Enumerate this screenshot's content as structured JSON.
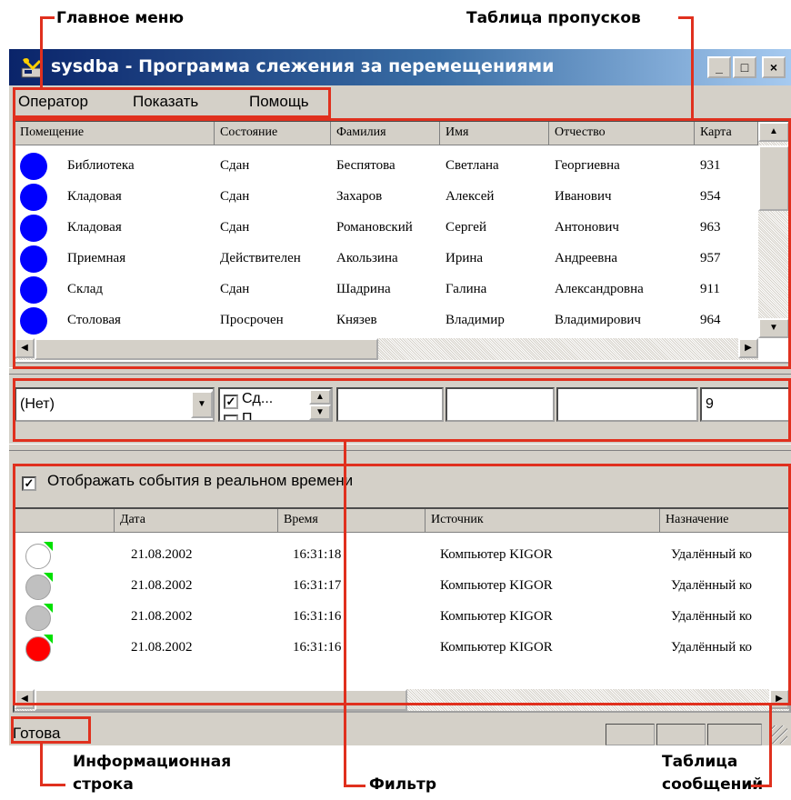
{
  "annotations": {
    "main_menu": "Главное меню",
    "pass_table": "Таблица пропусков",
    "info_line_1": "Информационная",
    "info_line_2": "строка",
    "filter": "Фильтр",
    "messages_1": "Таблица",
    "messages_2": "сообщений"
  },
  "window": {
    "title": "sysdba - Программа слежения за перемещениями",
    "buttons": [
      "_",
      "□",
      "×"
    ]
  },
  "menu": [
    "Оператор",
    "Показать",
    "Помощь"
  ],
  "pass_table": {
    "columns": [
      "Помещение",
      "Состояние",
      "Фамилия",
      "Имя",
      "Отчество",
      "Карта"
    ],
    "rows": [
      {
        "icon": "blue-circle-icon",
        "room": "Библиотека",
        "state": "Сдан",
        "last": "Беспятова",
        "first": "Светлана",
        "middle": "Георгиевна",
        "card": "931"
      },
      {
        "icon": "blue-circle-icon",
        "room": "Кладовая",
        "state": "Сдан",
        "last": "Захаров",
        "first": "Алексей",
        "middle": "Иванович",
        "card": "954"
      },
      {
        "icon": "blue-circle-icon",
        "room": "Кладовая",
        "state": "Сдан",
        "last": "Романовский",
        "first": "Сергей",
        "middle": "Антонович",
        "card": "963"
      },
      {
        "icon": "blue-circle-icon",
        "room": "Приемная",
        "state": "Действителен",
        "last": "Акользина",
        "first": "Ирина",
        "middle": "Андреевна",
        "card": "957"
      },
      {
        "icon": "blue-circle-icon",
        "room": "Склад",
        "state": "Сдан",
        "last": "Шадрина",
        "first": "Галина",
        "middle": "Александровна",
        "card": "911"
      },
      {
        "icon": "blue-circle-icon",
        "room": "Столовая",
        "state": "Просрочен",
        "last": "Князев",
        "first": "Владимир",
        "middle": "Владимирович",
        "card": "964"
      }
    ]
  },
  "filter": {
    "room_select_value": "(Нет)",
    "state_check_1": "Сд...",
    "state_check_2": "П...",
    "last_name_value": "",
    "first_name_value": "",
    "middle_name_value": "",
    "card_value": "9"
  },
  "realtime": {
    "label": "Отображать события в реальном времени",
    "checked": true
  },
  "messages_table": {
    "columns": [
      "",
      "Дата",
      "Время",
      "Источник",
      "Назначение"
    ],
    "rows": [
      {
        "icon": "white-circle-icon",
        "date": "21.08.2002",
        "time": "16:31:18",
        "source": "Компьютер KIGOR",
        "dest": "Удалённый ко"
      },
      {
        "icon": "gray-circle-icon",
        "date": "21.08.2002",
        "time": "16:31:17",
        "source": "Компьютер KIGOR",
        "dest": "Удалённый ко"
      },
      {
        "icon": "gray-circle-icon",
        "date": "21.08.2002",
        "time": "16:31:16",
        "source": "Компьютер KIGOR",
        "dest": "Удалённый ко"
      },
      {
        "icon": "red-circle-icon",
        "date": "21.08.2002",
        "time": "16:31:16",
        "source": "Компьютер KIGOR",
        "dest": "Удалённый ко"
      }
    ]
  },
  "status": {
    "text": "Готова"
  },
  "colors": {
    "annotation_red": "#e0301e",
    "blue_circle": "#0000ff",
    "gray_circle": "#c0c0c0",
    "red_circle": "#ff0000",
    "green_corner": "#00e000"
  }
}
